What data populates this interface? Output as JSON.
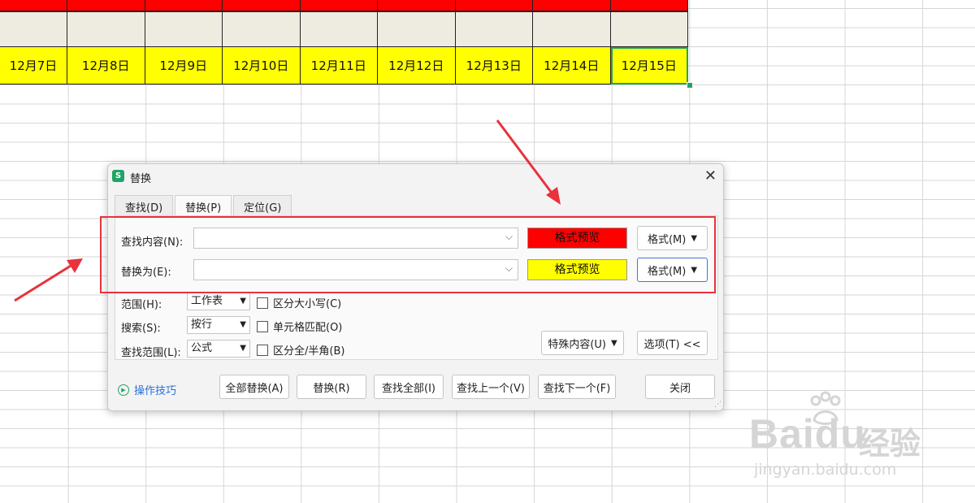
{
  "sheet": {
    "dates": [
      "12月7日",
      "12月8日",
      "12月9日",
      "12月10日",
      "12月11日",
      "12月12日",
      "12月13日",
      "12月14日",
      "12月15日"
    ]
  },
  "dialog": {
    "app_icon_letter": "S",
    "title": "替换",
    "tabs": [
      "查找(D)",
      "替换(P)",
      "定位(G)"
    ],
    "find_label": "查找内容(N):",
    "find_value": "",
    "replace_label": "替换为(E):",
    "replace_value": "",
    "preview_text": "格式预览",
    "preview_find_color": "#ff0000",
    "preview_replace_color": "#ffff00",
    "format_button": "格式(M)",
    "scope_label": "范围(H):",
    "scope_value": "工作表",
    "search_label": "搜索(S):",
    "search_value": "按行",
    "lookin_label": "查找范围(L):",
    "lookin_value": "公式",
    "match_case": "区分大小写(C)",
    "match_cell": "单元格匹配(O)",
    "match_width": "区分全/半角(B)",
    "special_button": "特殊内容(U)",
    "options_button": "选项(T) <<",
    "tips": "操作技巧",
    "buttons": [
      "全部替换(A)",
      "替换(R)",
      "查找全部(I)",
      "查找上一个(V)",
      "查找下一个(F)",
      "关闭"
    ]
  },
  "watermark": {
    "brand": "Baidu",
    "cn": "经验",
    "url": "jingyan.baidu.com"
  },
  "colors": {
    "annotation": "#e8323c",
    "accent": "#21a366"
  }
}
